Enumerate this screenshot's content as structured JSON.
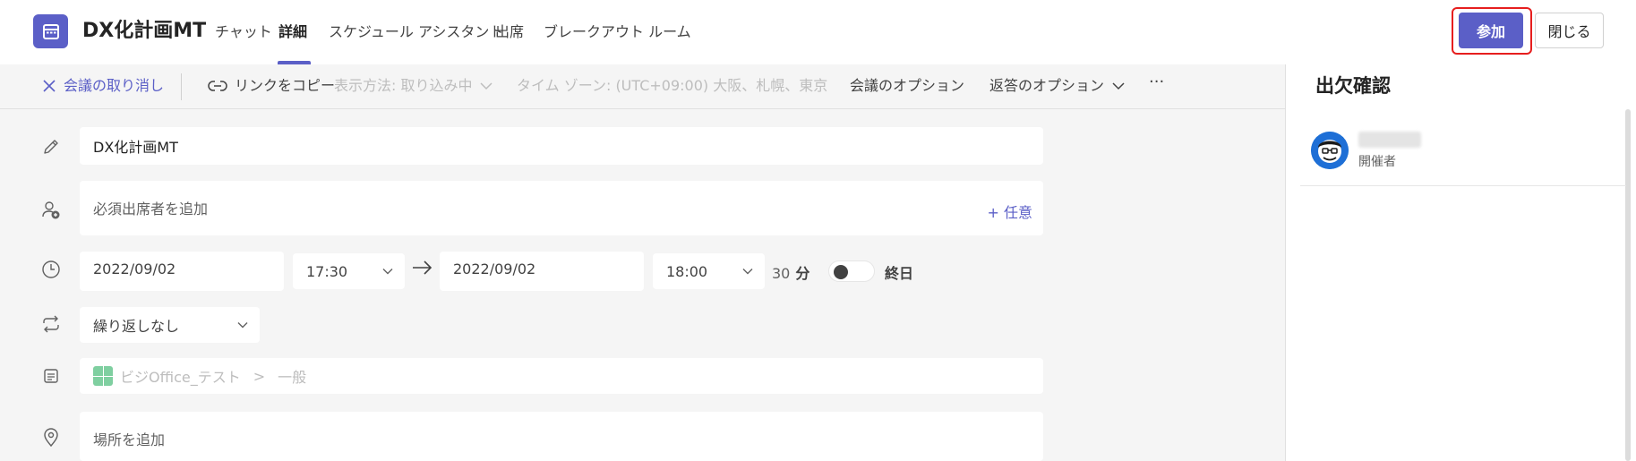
{
  "header": {
    "title": "DX化計画MT",
    "tabs": [
      {
        "label": "チャット",
        "active": false
      },
      {
        "label": "詳細",
        "active": true
      },
      {
        "label": "スケジュール アシスタント",
        "active": false
      },
      {
        "label": "出席",
        "active": false
      },
      {
        "label": "ブレークアウト ルーム",
        "active": false
      }
    ],
    "join_label": "参加",
    "close_label": "閉じる"
  },
  "toolbar": {
    "cancel_label": "会議の取り消し",
    "copy_link_label": "リンクをコピー",
    "display_label": "表示方法: 取り込み中",
    "timezone_label": "タイム ゾーン: (UTC+09:00) 大阪、札幌、東京",
    "meeting_options_label": "会議のオプション",
    "response_options_label": "返答のオプション",
    "more_label": "···"
  },
  "form": {
    "title_value": "DX化計画MT",
    "attendees_placeholder": "必須出席者を追加",
    "optional_label": "+ 任意",
    "start_date": "2022/09/02",
    "start_time": "17:30",
    "end_date": "2022/09/02",
    "end_time": "18:00",
    "duration_value": "30",
    "duration_unit": "分",
    "all_day_label": "終日",
    "all_day_on": false,
    "repeat_value": "繰り返しなし",
    "channel_team": "ビジOffice_テスト",
    "channel_separator": ">",
    "channel_name": "一般",
    "location_placeholder": "場所を追加"
  },
  "rsvp": {
    "title": "出欠確認",
    "attendees": [
      {
        "role": "開催者"
      }
    ]
  },
  "colors": {
    "accent": "#5b5fc7",
    "highlight_border": "#e61e1e",
    "background": "#f5f5f5"
  },
  "icons": {
    "app": "calendar-icon",
    "cancel": "close-icon",
    "copy_link": "link-icon",
    "title": "pencil-icon",
    "attendees": "add-person-icon",
    "time": "clock-icon",
    "repeat": "repeat-icon",
    "channel": "channel-icon",
    "location": "location-pin-icon"
  }
}
